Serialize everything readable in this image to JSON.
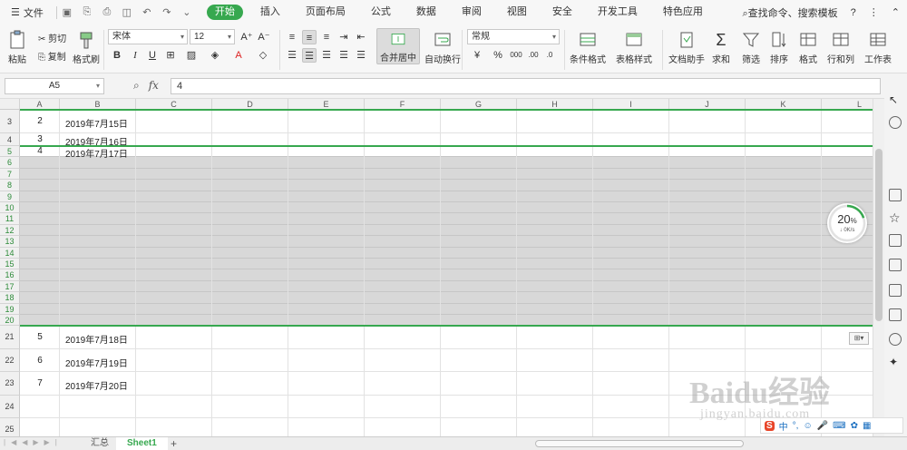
{
  "menu": {
    "file_label": "文件",
    "tabs": [
      "开始",
      "插入",
      "页面布局",
      "公式",
      "数据",
      "审阅",
      "视图",
      "安全",
      "开发工具",
      "特色应用"
    ],
    "active_tab": "开始",
    "search_label": "查找命令、搜索模板",
    "help": "?"
  },
  "ribbon": {
    "paste": "粘贴",
    "cut": "剪切",
    "copy": "复制",
    "format_painter": "格式刷",
    "font_name": "宋体",
    "font_size": "12",
    "bold": "B",
    "italic": "I",
    "underline": "U",
    "merge_center": "合并居中",
    "wrap_text": "自动换行",
    "number_format": "常规",
    "percent": "%",
    "cond_format": "条件格式",
    "table_style": "表格样式",
    "doc_helper": "文档助手",
    "sum": "求和",
    "filter": "筛选",
    "sort": "排序",
    "format": "格式",
    "rows_cols": "行和列",
    "worksheet": "工作表"
  },
  "formula_bar": {
    "name_box": "A5",
    "fx": "fx",
    "value": "4"
  },
  "columns": [
    "A",
    "B",
    "C",
    "D",
    "E",
    "F",
    "G",
    "H",
    "I",
    "J",
    "K",
    "L"
  ],
  "rows": [
    {
      "n": "3",
      "a": "2",
      "b": "2019年7月15日"
    },
    {
      "n": "4",
      "a": "3",
      "b": "2019年7月16日"
    },
    {
      "n": "5",
      "a": "4",
      "b": "2019年7月17日"
    },
    {
      "n": "6"
    },
    {
      "n": "7"
    },
    {
      "n": "8"
    },
    {
      "n": "9"
    },
    {
      "n": "10"
    },
    {
      "n": "11"
    },
    {
      "n": "12"
    },
    {
      "n": "13"
    },
    {
      "n": "14"
    },
    {
      "n": "15"
    },
    {
      "n": "16"
    },
    {
      "n": "17"
    },
    {
      "n": "18"
    },
    {
      "n": "19"
    },
    {
      "n": "20"
    },
    {
      "n": "21",
      "a": "5",
      "b": "2019年7月18日"
    },
    {
      "n": "22",
      "a": "6",
      "b": "2019年7月19日"
    },
    {
      "n": "23",
      "a": "7",
      "b": "2019年7月20日"
    },
    {
      "n": "24"
    },
    {
      "n": "25"
    }
  ],
  "speed_widget": {
    "percent": "20",
    "unit": "%",
    "rate": "0K/s",
    "progress": 0.2
  },
  "sheets": {
    "tabs": [
      "汇总",
      "Sheet1"
    ],
    "active": "Sheet1",
    "add": "+"
  },
  "watermark": {
    "main": "Baidu经验",
    "sub": "jingyan.baidu.com"
  },
  "colors": {
    "accent": "#37a84f"
  }
}
